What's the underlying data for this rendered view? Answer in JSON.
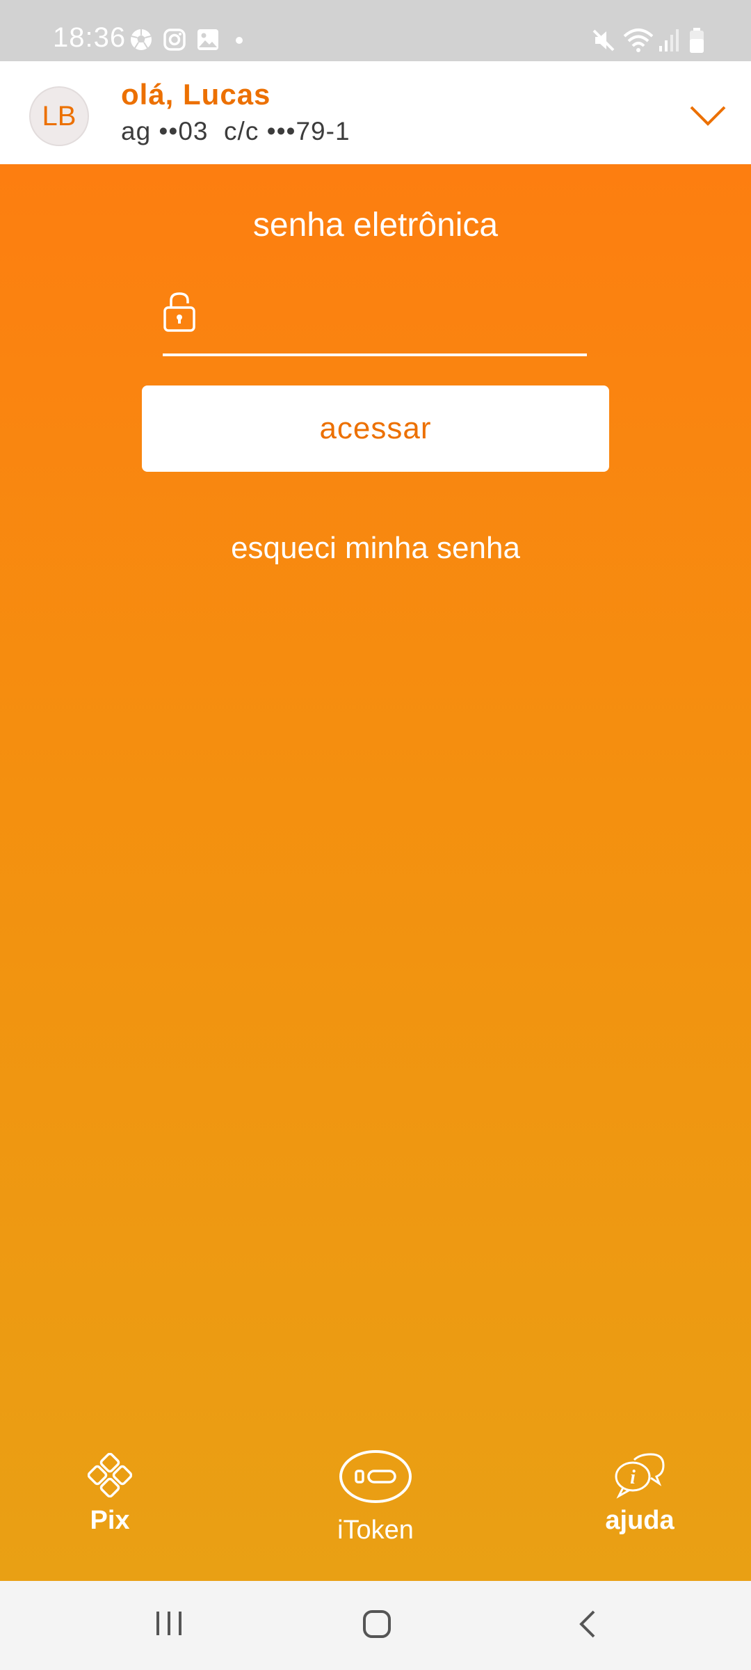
{
  "status_bar": {
    "time": "18:36",
    "left_icons": [
      "soccer-ball-icon",
      "instagram-icon",
      "gallery-icon",
      "dot-icon"
    ],
    "right_icons": [
      "mute-icon",
      "wifi-icon",
      "signal-icon",
      "battery-icon"
    ]
  },
  "account": {
    "avatar_initials": "LB",
    "greeting": "olá, Lucas",
    "account_info": "ag ••03  c/c •••79-1",
    "expand_icon": "chevron-down-icon"
  },
  "login": {
    "title": "senha eletrônica",
    "password_placeholder": "",
    "access_label": "acessar",
    "forgot_label": "esqueci minha senha"
  },
  "shortcuts": [
    {
      "label": "Pix",
      "icon": "pix-icon"
    },
    {
      "label": "iToken",
      "icon": "itoken-icon"
    },
    {
      "label": "ajuda",
      "icon": "help-chat-icon"
    }
  ],
  "nav": [
    "recent-apps-icon",
    "home-icon",
    "back-icon"
  ],
  "colors": {
    "brand_orange": "#ec7000",
    "gradient_top": "#fd7e10",
    "gradient_bottom": "#e9a014",
    "status_bar_bg": "#d2d2d2"
  }
}
